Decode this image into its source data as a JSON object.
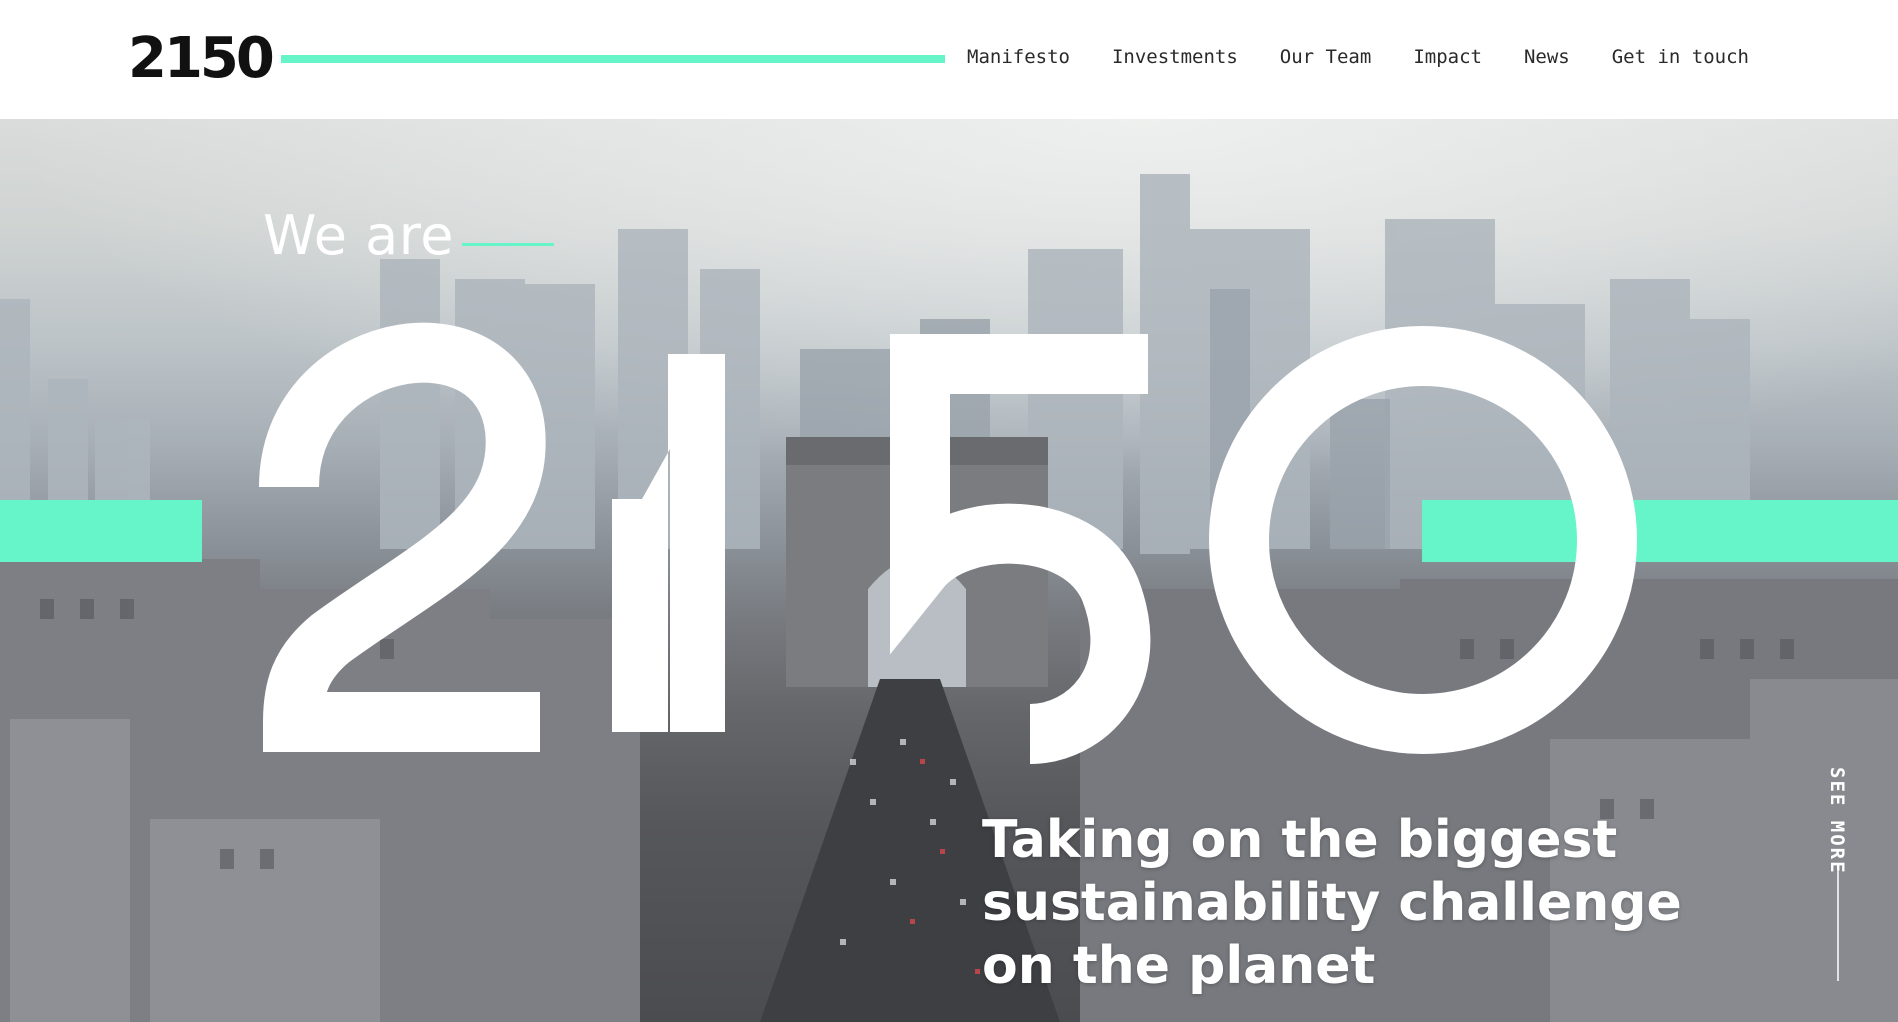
{
  "header": {
    "logo_text": "2150",
    "nav": [
      {
        "label": "Manifesto"
      },
      {
        "label": "Investments"
      },
      {
        "label": "Our Team"
      },
      {
        "label": "Impact"
      },
      {
        "label": "News"
      },
      {
        "label": "Get in touch"
      }
    ]
  },
  "hero": {
    "intro": "We are",
    "big_number": "2150",
    "tagline_lines": [
      "Taking on the biggest",
      "sustainability challenge",
      "on the planet"
    ],
    "see_more": "SEE MORE"
  },
  "colors": {
    "accent": "#66f5c8",
    "text_dark": "#111111",
    "white": "#ffffff"
  },
  "icons": [
    "logo-wordmark",
    "scroll-indicator-line"
  ]
}
